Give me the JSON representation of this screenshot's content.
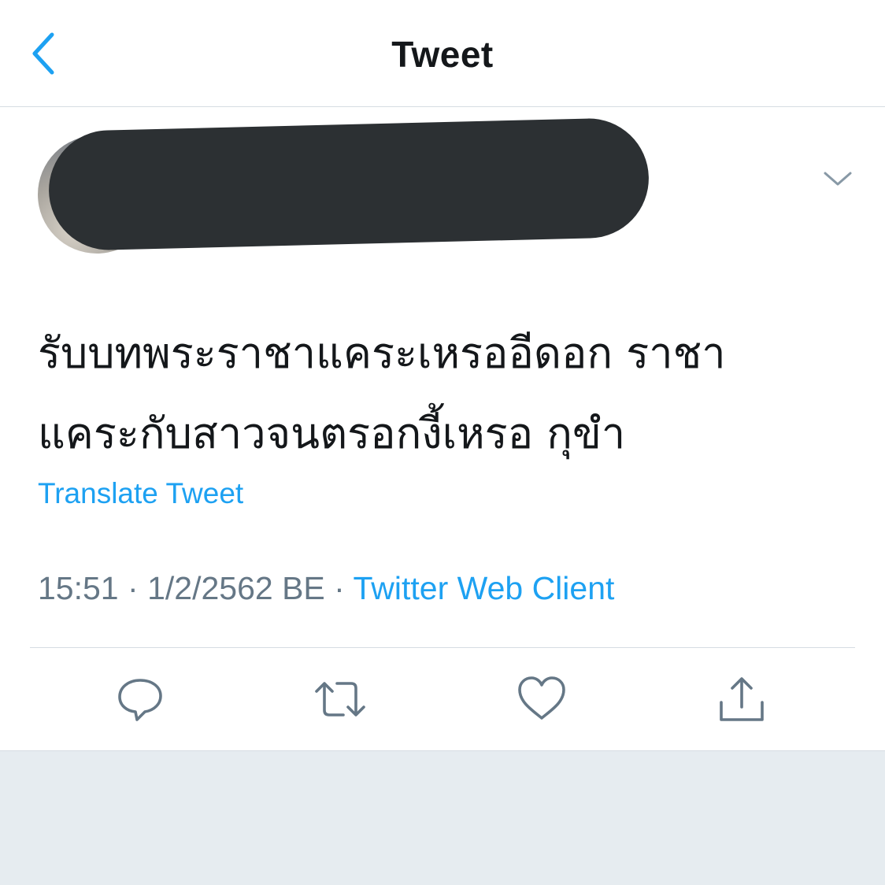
{
  "header": {
    "title": "Tweet",
    "back_icon": "chevron-left-icon"
  },
  "author": {
    "avatar_icon": "avatar",
    "menu_icon": "chevron-down-icon"
  },
  "tweet": {
    "text_line1": "รับบทพระราชาแคระเหรออีดอก ราชา",
    "text_line2": "แคระกับสาวจนตรอกงี้เหรอ กุขำ",
    "translate_label": "Translate Tweet"
  },
  "meta": {
    "time": "15:51",
    "date": "1/2/2562 BE",
    "separator": "·",
    "source": "Twitter Web Client"
  },
  "actions": {
    "reply_icon": "reply-icon",
    "retweet_icon": "retweet-icon",
    "like_icon": "heart-icon",
    "share_icon": "share-icon"
  },
  "colors": {
    "accent": "#1da1f2",
    "text": "#14171a",
    "secondary": "#657786",
    "icon": "#657786",
    "divider": "#d6dce2",
    "footer": "#e6ecf0"
  }
}
